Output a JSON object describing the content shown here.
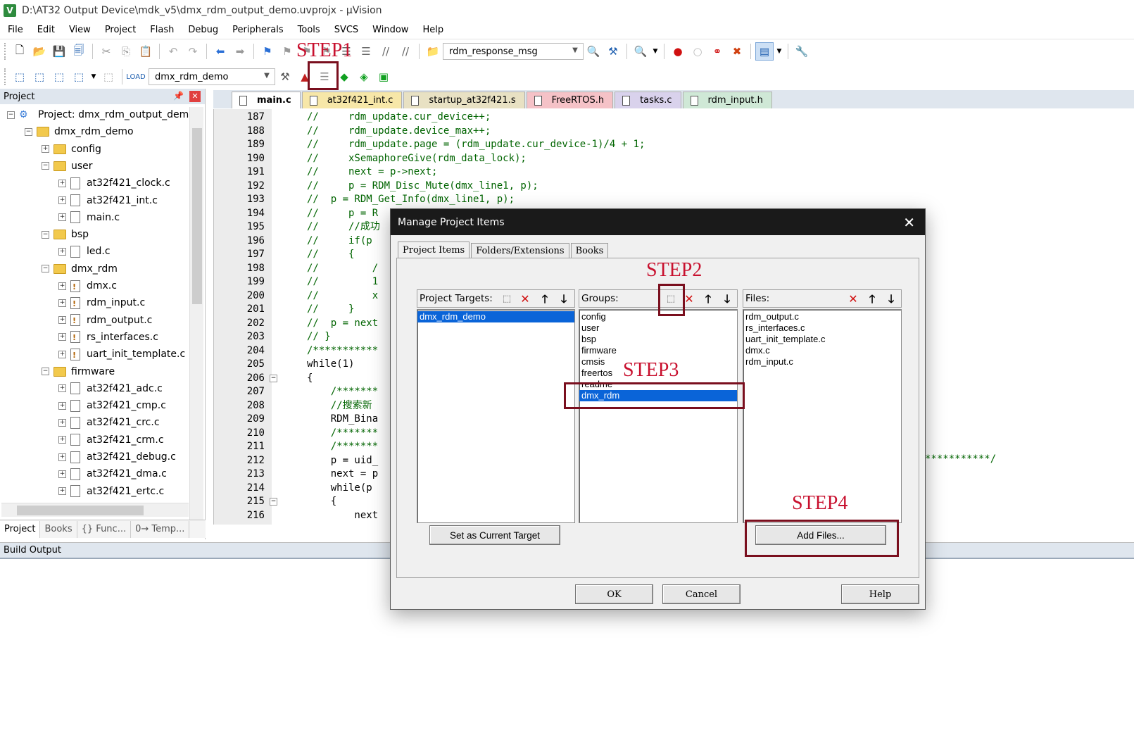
{
  "window": {
    "title": "D:\\AT32 Output Device\\mdk_v5\\dmx_rdm_output_demo.uvprojx - µVision"
  },
  "menu": [
    "File",
    "Edit",
    "View",
    "Project",
    "Flash",
    "Debug",
    "Peripherals",
    "Tools",
    "SVCS",
    "Window",
    "Help"
  ],
  "toolbar": {
    "find_combo_value": "rdm_response_msg",
    "target_combo_value": "dmx_rdm_demo"
  },
  "project_panel": {
    "title": "Project",
    "tabs": [
      "Project",
      "Books",
      "{} Func...",
      "0→ Temp..."
    ],
    "tree": [
      {
        "label": "Project: dmx_rdm_output_demo",
        "level": 0,
        "kind": "project",
        "exp": "−"
      },
      {
        "label": "dmx_rdm_demo",
        "level": 1,
        "kind": "target",
        "exp": "−"
      },
      {
        "label": "config",
        "level": 2,
        "kind": "folder",
        "exp": "+"
      },
      {
        "label": "user",
        "level": 2,
        "kind": "folder",
        "exp": "−"
      },
      {
        "label": "at32f421_clock.c",
        "level": 3,
        "kind": "file",
        "exp": "+"
      },
      {
        "label": "at32f421_int.c",
        "level": 3,
        "kind": "file",
        "exp": "+"
      },
      {
        "label": "main.c",
        "level": 3,
        "kind": "file",
        "exp": "+"
      },
      {
        "label": "bsp",
        "level": 2,
        "kind": "folder",
        "exp": "−"
      },
      {
        "label": "led.c",
        "level": 3,
        "kind": "file",
        "exp": "+"
      },
      {
        "label": "dmx_rdm",
        "level": 2,
        "kind": "folder",
        "exp": "−"
      },
      {
        "label": "dmx.c",
        "level": 3,
        "kind": "warn",
        "exp": "+"
      },
      {
        "label": "rdm_input.c",
        "level": 3,
        "kind": "warn",
        "exp": "+"
      },
      {
        "label": "rdm_output.c",
        "level": 3,
        "kind": "warn",
        "exp": "+"
      },
      {
        "label": "rs_interfaces.c",
        "level": 3,
        "kind": "warn",
        "exp": "+"
      },
      {
        "label": "uart_init_template.c",
        "level": 3,
        "kind": "warn",
        "exp": "+"
      },
      {
        "label": "firmware",
        "level": 2,
        "kind": "folder",
        "exp": "−"
      },
      {
        "label": "at32f421_adc.c",
        "level": 3,
        "kind": "file",
        "exp": "+"
      },
      {
        "label": "at32f421_cmp.c",
        "level": 3,
        "kind": "file",
        "exp": "+"
      },
      {
        "label": "at32f421_crc.c",
        "level": 3,
        "kind": "file",
        "exp": "+"
      },
      {
        "label": "at32f421_crm.c",
        "level": 3,
        "kind": "file",
        "exp": "+"
      },
      {
        "label": "at32f421_debug.c",
        "level": 3,
        "kind": "file",
        "exp": "+"
      },
      {
        "label": "at32f421_dma.c",
        "level": 3,
        "kind": "file",
        "exp": "+"
      },
      {
        "label": "at32f421_ertc.c",
        "level": 3,
        "kind": "file",
        "exp": "+"
      }
    ]
  },
  "editor_tabs": [
    {
      "label": "main.c",
      "color": "#ffffff",
      "active": true
    },
    {
      "label": "at32f421_int.c",
      "color": "#f7e7a8",
      "active": false
    },
    {
      "label": "startup_at32f421.s",
      "color": "#e8e1c3",
      "active": false
    },
    {
      "label": "FreeRTOS.h",
      "color": "#f5c2c7",
      "active": false
    },
    {
      "label": "tasks.c",
      "color": "#d9d2ec",
      "active": false
    },
    {
      "label": "rdm_input.h",
      "color": "#cfe8d6",
      "active": false
    }
  ],
  "code_lines": [
    {
      "n": "187",
      "t": "//     rdm_update.cur_device++;",
      "s": "c"
    },
    {
      "n": "188",
      "t": "//     rdm_update.device_max++;",
      "s": "c"
    },
    {
      "n": "189",
      "t": "//     rdm_update.page = (rdm_update.cur_device-1)/4 + 1;",
      "s": "c"
    },
    {
      "n": "190",
      "t": "//     xSemaphoreGive(rdm_data_lock);",
      "s": "c"
    },
    {
      "n": "191",
      "t": "//     next = p->next;",
      "s": "c"
    },
    {
      "n": "192",
      "t": "//     p = RDM_Disc_Mute(dmx_line1, p);",
      "s": "c"
    },
    {
      "n": "193",
      "t": "//  p = RDM_Get_Info(dmx_line1, p);",
      "s": "c"
    },
    {
      "n": "194",
      "t": "//     p = R",
      "s": "c"
    },
    {
      "n": "195",
      "t": "//     //成功",
      "s": "c"
    },
    {
      "n": "196",
      "t": "//     if(p",
      "s": "c"
    },
    {
      "n": "197",
      "t": "//     {",
      "s": "c"
    },
    {
      "n": "198",
      "t": "//         /",
      "s": "c"
    },
    {
      "n": "199",
      "t": "//         1",
      "s": "c"
    },
    {
      "n": "200",
      "t": "//         x",
      "s": "c"
    },
    {
      "n": "201",
      "t": "//     }",
      "s": "c"
    },
    {
      "n": "202",
      "t": "//  p = next",
      "s": "c"
    },
    {
      "n": "203",
      "t": "// }",
      "s": "c"
    },
    {
      "n": "204",
      "t": "/***********",
      "s": "c"
    },
    {
      "n": "205",
      "t": "while(1)",
      "s": "k"
    },
    {
      "n": "206",
      "t": "{",
      "s": "p"
    },
    {
      "n": "207",
      "t": "    /*******",
      "s": "c"
    },
    {
      "n": "208",
      "t": "    //搜索新",
      "s": "c"
    },
    {
      "n": "209",
      "t": "    RDM_Bina",
      "s": "p"
    },
    {
      "n": "210",
      "t": "    /*******",
      "s": "c"
    },
    {
      "n": "211",
      "t": "    /*******",
      "s": "c"
    },
    {
      "n": "212",
      "t": "    p = uid_",
      "s": "p"
    },
    {
      "n": "213",
      "t": "    next = p",
      "s": "p"
    },
    {
      "n": "214",
      "t": "    while(p",
      "s": "k"
    },
    {
      "n": "215",
      "t": "    {",
      "s": "p"
    },
    {
      "n": "216",
      "t": "        next",
      "s": "p"
    }
  ],
  "code_right_fragment": "***********/",
  "build_output": {
    "title": "Build Output"
  },
  "dialog": {
    "title": "Manage Project Items",
    "tabs": [
      "Project Items",
      "Folders/Extensions",
      "Books"
    ],
    "targets_label": "Project Targets:",
    "groups_label": "Groups:",
    "files_label": "Files:",
    "targets": [
      "dmx_rdm_demo"
    ],
    "groups": [
      "config",
      "user",
      "bsp",
      "firmware",
      "cmsis",
      "freertos",
      "readme",
      "dmx_rdm"
    ],
    "files": [
      "rdm_output.c",
      "rs_interfaces.c",
      "uart_init_template.c",
      "dmx.c",
      "rdm_input.c"
    ],
    "set_current_label": "Set as Current Target",
    "add_files_label": "Add Files...",
    "ok_label": "OK",
    "cancel_label": "Cancel",
    "help_label": "Help"
  },
  "annotations": {
    "step1": "STEP1",
    "step2": "STEP2",
    "step3": "STEP3",
    "step4": "STEP4",
    "color": "#c8102e"
  }
}
